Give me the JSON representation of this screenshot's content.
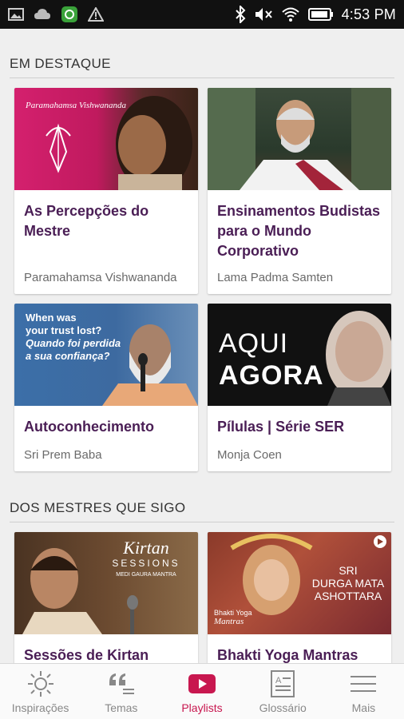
{
  "status_bar": {
    "time": "4:53 PM",
    "left_icons": [
      "image-icon",
      "cloud-icon",
      "app-badge-icon",
      "warning-icon"
    ],
    "right_icons": [
      "bluetooth-icon",
      "mute-icon",
      "wifi-icon",
      "battery-icon"
    ]
  },
  "sections": [
    {
      "title": "EM DESTAQUE",
      "cards": [
        {
          "title": "As Percepções do Mestre",
          "author": "Paramahamsa Vishwananda",
          "image_caption": "Paramahamsa Vishwananda"
        },
        {
          "title": "Ensinamentos Budistas para o Mundo Corporativo",
          "author": "Lama Padma Samten"
        },
        {
          "title": "Autoconhecimento",
          "author": "Sri Prem Baba",
          "image_caption": [
            "When was",
            "your trust lost?",
            "Quando foi perdida",
            "a sua confiança?"
          ]
        },
        {
          "title": "Pílulas | Série SER",
          "author": "Monja Coen",
          "image_caption": [
            "AQUI",
            "AGORA"
          ]
        }
      ]
    },
    {
      "title": "DOS MESTRES QUE SIGO",
      "cards": [
        {
          "title": "Sessões de Kirtan",
          "image_caption": [
            "Kirtan",
            "SESSIONS",
            "MEDI GAURA MANTRA"
          ]
        },
        {
          "title": "Bhakti Yoga Mantras",
          "image_caption": [
            "SRI",
            "DURGA MATA",
            "ASHOTTARA",
            "Bhakti Yoga",
            "Mantras"
          ]
        }
      ]
    }
  ],
  "nav": [
    {
      "label": "Inspirações",
      "icon": "sun-icon",
      "active": false
    },
    {
      "label": "Temas",
      "icon": "quote-icon",
      "active": false
    },
    {
      "label": "Playlists",
      "icon": "play-icon",
      "active": true
    },
    {
      "label": "Glossário",
      "icon": "glossary-icon",
      "active": false
    },
    {
      "label": "Mais",
      "icon": "menu-icon",
      "active": false
    }
  ],
  "colors": {
    "accent": "#c8174f",
    "card_title": "#4a1e55"
  }
}
